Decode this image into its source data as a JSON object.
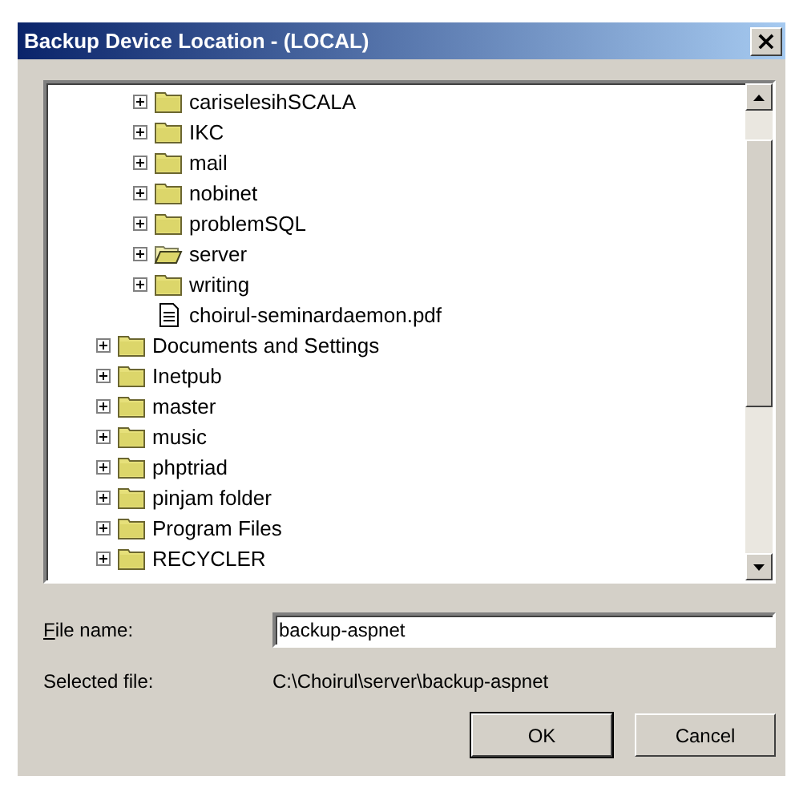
{
  "window": {
    "title": "Backup Device Location - (LOCAL)",
    "close": "×"
  },
  "tree": {
    "inner_items": [
      {
        "label": "cariselesihSCALA",
        "kind": "folder",
        "open": false
      },
      {
        "label": "IKC",
        "kind": "folder",
        "open": false
      },
      {
        "label": "mail",
        "kind": "folder",
        "open": false
      },
      {
        "label": "nobinet",
        "kind": "folder",
        "open": false
      },
      {
        "label": "problemSQL",
        "kind": "folder",
        "open": false
      },
      {
        "label": "server",
        "kind": "folder",
        "open": true
      },
      {
        "label": "writing",
        "kind": "folder",
        "open": false
      },
      {
        "label": "choirul-seminardaemon.pdf",
        "kind": "file"
      }
    ],
    "outer_items": [
      {
        "label": "Documents and Settings",
        "kind": "folder",
        "open": false
      },
      {
        "label": "Inetpub",
        "kind": "folder",
        "open": false
      },
      {
        "label": "master",
        "kind": "folder",
        "open": false
      },
      {
        "label": "music",
        "kind": "folder",
        "open": false
      },
      {
        "label": "phptriad",
        "kind": "folder",
        "open": false
      },
      {
        "label": "pinjam folder",
        "kind": "folder",
        "open": false
      },
      {
        "label": "Program Files",
        "kind": "folder",
        "open": false
      },
      {
        "label": "RECYCLER",
        "kind": "folder",
        "open": false
      }
    ]
  },
  "file_name": {
    "label": "**F**ile name:",
    "value": "backup-aspnet"
  },
  "selected_file": {
    "label": "Selected file:",
    "value": "C:\\Choirul\\server\\backup-aspnet"
  },
  "buttons": [
    "OK",
    "Cancel"
  ]
}
